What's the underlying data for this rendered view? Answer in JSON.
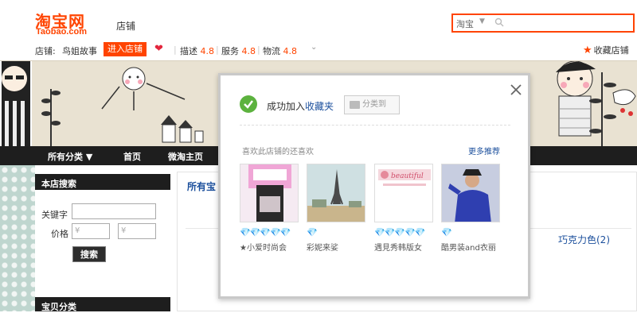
{
  "header": {
    "logo_cn": "淘宝网",
    "logo_en": "Taobao.com",
    "store_label": "店铺",
    "search": {
      "scope": "淘宝",
      "scope_caret": "▼"
    }
  },
  "store_bar": {
    "label": "店铺:",
    "name": "鸟姐故事",
    "enter_button": "进入店铺",
    "desc_label": "描述",
    "desc_score": "4.8",
    "service_label": "服务",
    "service_score": "4.8",
    "logistics_label": "物流",
    "logistics_score": "4.8",
    "favorite_store": "收藏店铺"
  },
  "nav": {
    "items": [
      "所有分类 ▼",
      "首页",
      "微淘主页"
    ]
  },
  "left": {
    "search_title": "本店搜索",
    "keyword_label": "关键字",
    "price_label": "价格",
    "price_min_placeholder": "¥",
    "price_max_placeholder": "¥",
    "search_button": "搜索",
    "category_title": "宝贝分类"
  },
  "main": {
    "title": "所有宝",
    "chocolate": "巧克力色(2)"
  },
  "modal": {
    "success_prefix": "成功加入",
    "success_link": "收藏夹",
    "category_button": "分类到",
    "also_like": "喜欢此店铺的还喜欢",
    "more_recommend": "更多推荐",
    "recommendations": [
      {
        "name": "★小爱时尚会",
        "badges": "💎💎💎💎💎"
      },
      {
        "name": "彩妮来娑",
        "badges": "💎"
      },
      {
        "name": "遇見秀韩版女",
        "badges": "💎💎💎💎💎"
      },
      {
        "name": "酷男装and衣丽",
        "badges": "💎"
      }
    ]
  },
  "colors": {
    "brand": "#ff4400",
    "link": "#1b4f9c",
    "success": "#5cb23e"
  }
}
